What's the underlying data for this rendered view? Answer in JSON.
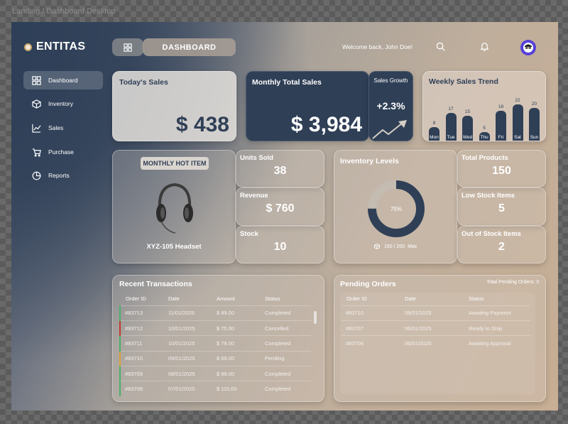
{
  "frame_label": "Landing / Dashboard Desktop",
  "brand": {
    "name": "ENTITAS"
  },
  "sidebar": {
    "items": [
      {
        "label": "Dashboard",
        "icon": "grid-icon",
        "active": true
      },
      {
        "label": "Inventory",
        "icon": "box-icon",
        "active": false
      },
      {
        "label": "Sales",
        "icon": "chart-line-icon",
        "active": false
      },
      {
        "label": "Purchase",
        "icon": "cart-icon",
        "active": false
      },
      {
        "label": "Reports",
        "icon": "pie-icon",
        "active": false
      }
    ]
  },
  "header": {
    "title": "DASHBOARD",
    "welcome": "Welcome back, John Doe!"
  },
  "todays_sales": {
    "title": "Today's Sales",
    "value": "$ 438"
  },
  "monthly_sales": {
    "title": "Monthly Total Sales",
    "value": "$ 3,984"
  },
  "sales_growth": {
    "title": "Sales Growth",
    "value": "+2.3%"
  },
  "weekly_trend": {
    "title": "Weekly Sales Trend",
    "days": [
      "Mon",
      "Tue",
      "Wed",
      "Thu",
      "Fri",
      "Sat",
      "Sun"
    ],
    "values": [
      8,
      17,
      15,
      5,
      18,
      22,
      20
    ]
  },
  "hot_item": {
    "title": "MONTHLY HOT ITEM",
    "name": "XYZ-105 Headset"
  },
  "stats_left": [
    {
      "label": "Units Sold",
      "value": "38"
    },
    {
      "label": "Revenue",
      "value": "$ 760"
    },
    {
      "label": "Stock",
      "value": "10"
    }
  ],
  "inventory": {
    "title": "Inventory Levels",
    "percent_label": "75%",
    "fraction": 0.75,
    "caption": "150 / 200  Max"
  },
  "stats_right": [
    {
      "label": "Total Products",
      "value": "150"
    },
    {
      "label": "Low Stock Items",
      "value": "5"
    },
    {
      "label": "Out of Stock Items",
      "value": "2"
    }
  ],
  "transactions": {
    "title": "Recent Transactions",
    "columns": [
      "Order ID",
      "Date",
      "Amount",
      "Status"
    ],
    "rows": [
      {
        "id": "#83713",
        "date": "11/01/2025",
        "amount": "$ 89.00",
        "status": "Completed",
        "color": "#4caf6a"
      },
      {
        "id": "#83712",
        "date": "10/01/2025",
        "amount": "$ 75.00",
        "status": "Cancelled",
        "color": "#c0392b"
      },
      {
        "id": "#83711",
        "date": "10/01/2025",
        "amount": "$ 79.00",
        "status": "Completed",
        "color": "#4caf6a"
      },
      {
        "id": "#83710",
        "date": "09/01/2025",
        "amount": "$ 69.00",
        "status": "Pending",
        "color": "#d8a13a"
      },
      {
        "id": "#83709",
        "date": "08/01/2025",
        "amount": "$ 89.00",
        "status": "Completed",
        "color": "#4caf6a"
      },
      {
        "id": "#83708",
        "date": "07/01/2025",
        "amount": "$ 115.00",
        "status": "Completed",
        "color": "#4caf6a"
      }
    ]
  },
  "pending": {
    "title": "Pending Orders",
    "total_label": "Total Pending Orders: 3",
    "columns": [
      "Order ID",
      "Date",
      "Status"
    ],
    "rows": [
      {
        "id": "#83710",
        "date": "09/01/2025",
        "status": "Awaiting Payment"
      },
      {
        "id": "#83707",
        "date": "06/01/2025",
        "status": "Ready to Ship"
      },
      {
        "id": "#83706",
        "date": "06/01/2025",
        "status": "Awaiting Approval"
      }
    ]
  },
  "colors": {
    "navy": "#2f3f56",
    "avatar": "#5540d9",
    "completed": "#4caf6a",
    "cancelled": "#c0392b",
    "pending": "#d8a13a"
  }
}
